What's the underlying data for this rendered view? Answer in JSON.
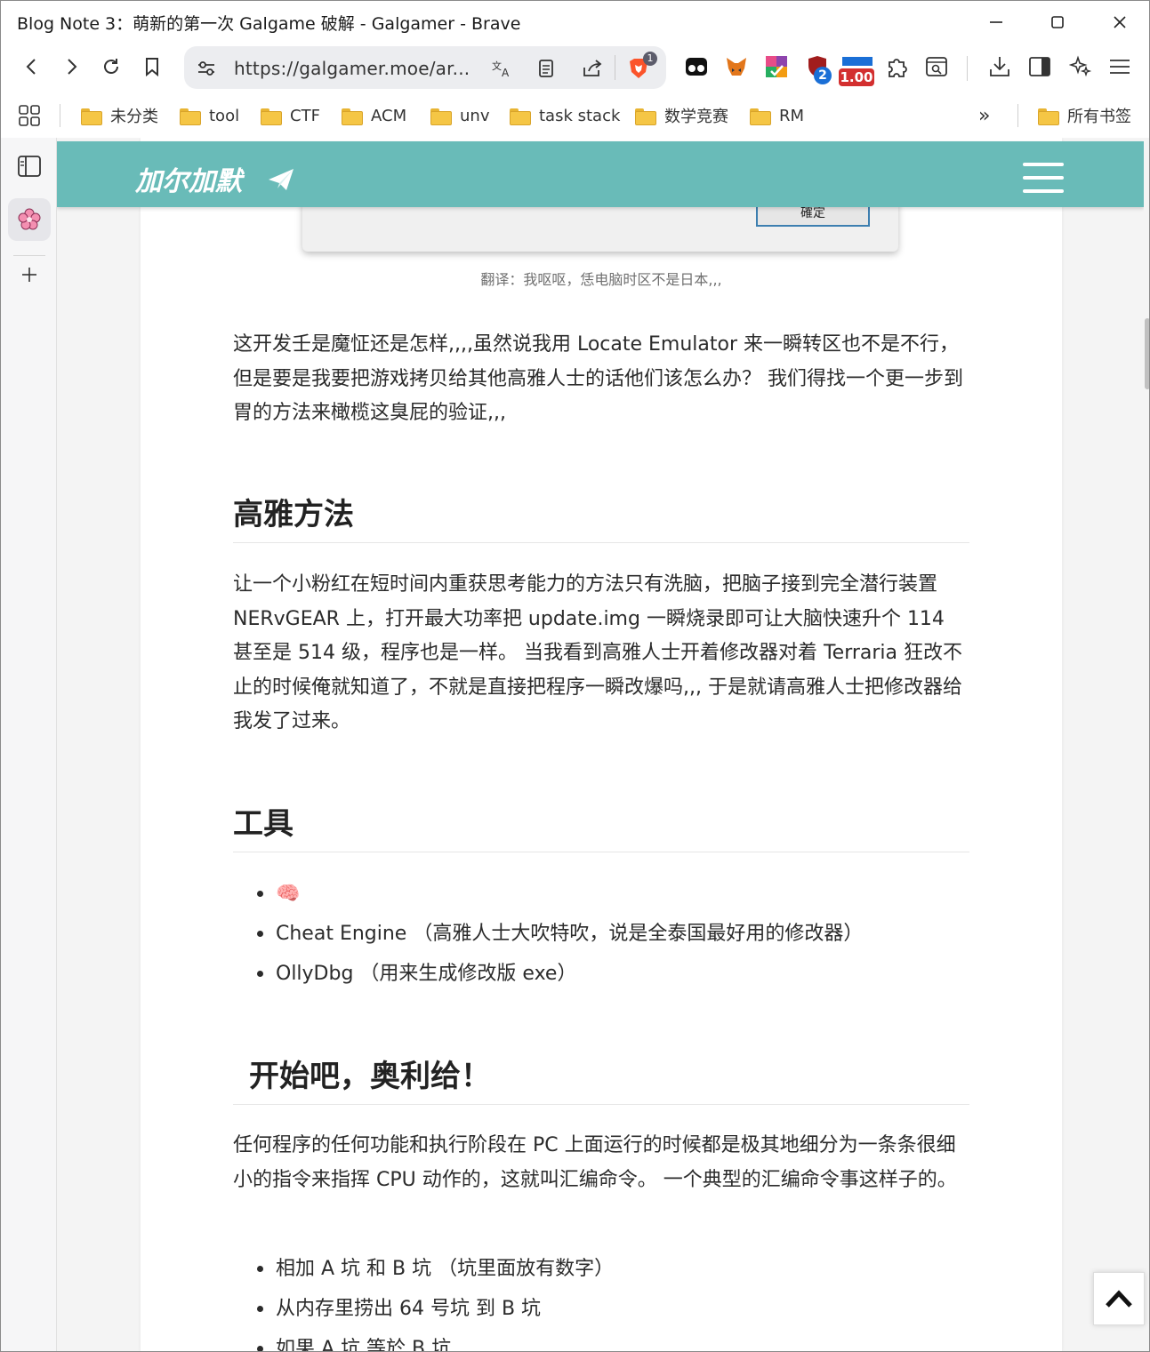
{
  "window": {
    "title": "Blog Note 3：萌新的第一次 Galgame 破解 - Galgamer - Brave"
  },
  "toolbar": {
    "url": "https://galgamer.moe/ar...",
    "shields_badge": "1",
    "ext_badge_count": "2",
    "ext_badge_value": "1.00"
  },
  "bookmarks": {
    "items": [
      {
        "label": "未分类"
      },
      {
        "label": "tool"
      },
      {
        "label": "CTF"
      },
      {
        "label": "ACM"
      },
      {
        "label": "unv"
      },
      {
        "label": "task stack"
      },
      {
        "label": "数学竞赛"
      },
      {
        "label": "RM"
      }
    ],
    "overflow": "»",
    "all_bookmarks": "所有书签"
  },
  "site": {
    "title": "加尔加默"
  },
  "article": {
    "dialog_button": "確定",
    "caption": "翻译：我呕呕，恁电脑时区不是日本,,,",
    "para1": "这开发壬是魔怔还是怎样,,,,虽然说我用 Locate Emulator 来一瞬转区也不是不行，但是要是我要把游戏拷贝给其他高雅人士的话他们该怎么办？ 我们得找一个更一步到胃的方法来橄榄这臭屁的验证,,,",
    "h_method": "高雅方法",
    "para2": "让一个小粉红在短时间内重获思考能力的方法只有洗脑，把脑子接到完全潜行装置 NERvGEAR 上，打开最大功率把 update.img 一瞬烧录即可让大脑快速升个 114 甚至是 514 级，程序也是一样。 当我看到高雅人士开着修改器对着 Terraria 狂改不止的时候俺就知道了，不就是直接把程序一瞬改爆吗,,, 于是就请高雅人士把修改器给我发了过来。",
    "h_tools": "工具",
    "tools": [
      "🧠",
      "Cheat Engine （高雅人士大吹特吹，说是全泰国最好用的修改器）",
      " OllyDbg （用来生成修改版 exe）"
    ],
    "h_start": "开始吧，奥利给！",
    "para3": "任何程序的任何功能和执行阶段在 PC 上面运行的时候都是极其地细分为一条条很细小的指令来指挥 CPU 动作的，这就叫汇编命令。 一个典型的汇编命令事这样子的。",
    "steps": [
      "相加 A 坑 和 B 坑 （坑里面放有数字）",
      "从内存里捞出 64 号坑 到 B 坑",
      "如果 A 坑 等於 B 坑"
    ]
  },
  "colors": {
    "header_bg": "#69bbb8",
    "brave_orange": "#fb542b"
  }
}
